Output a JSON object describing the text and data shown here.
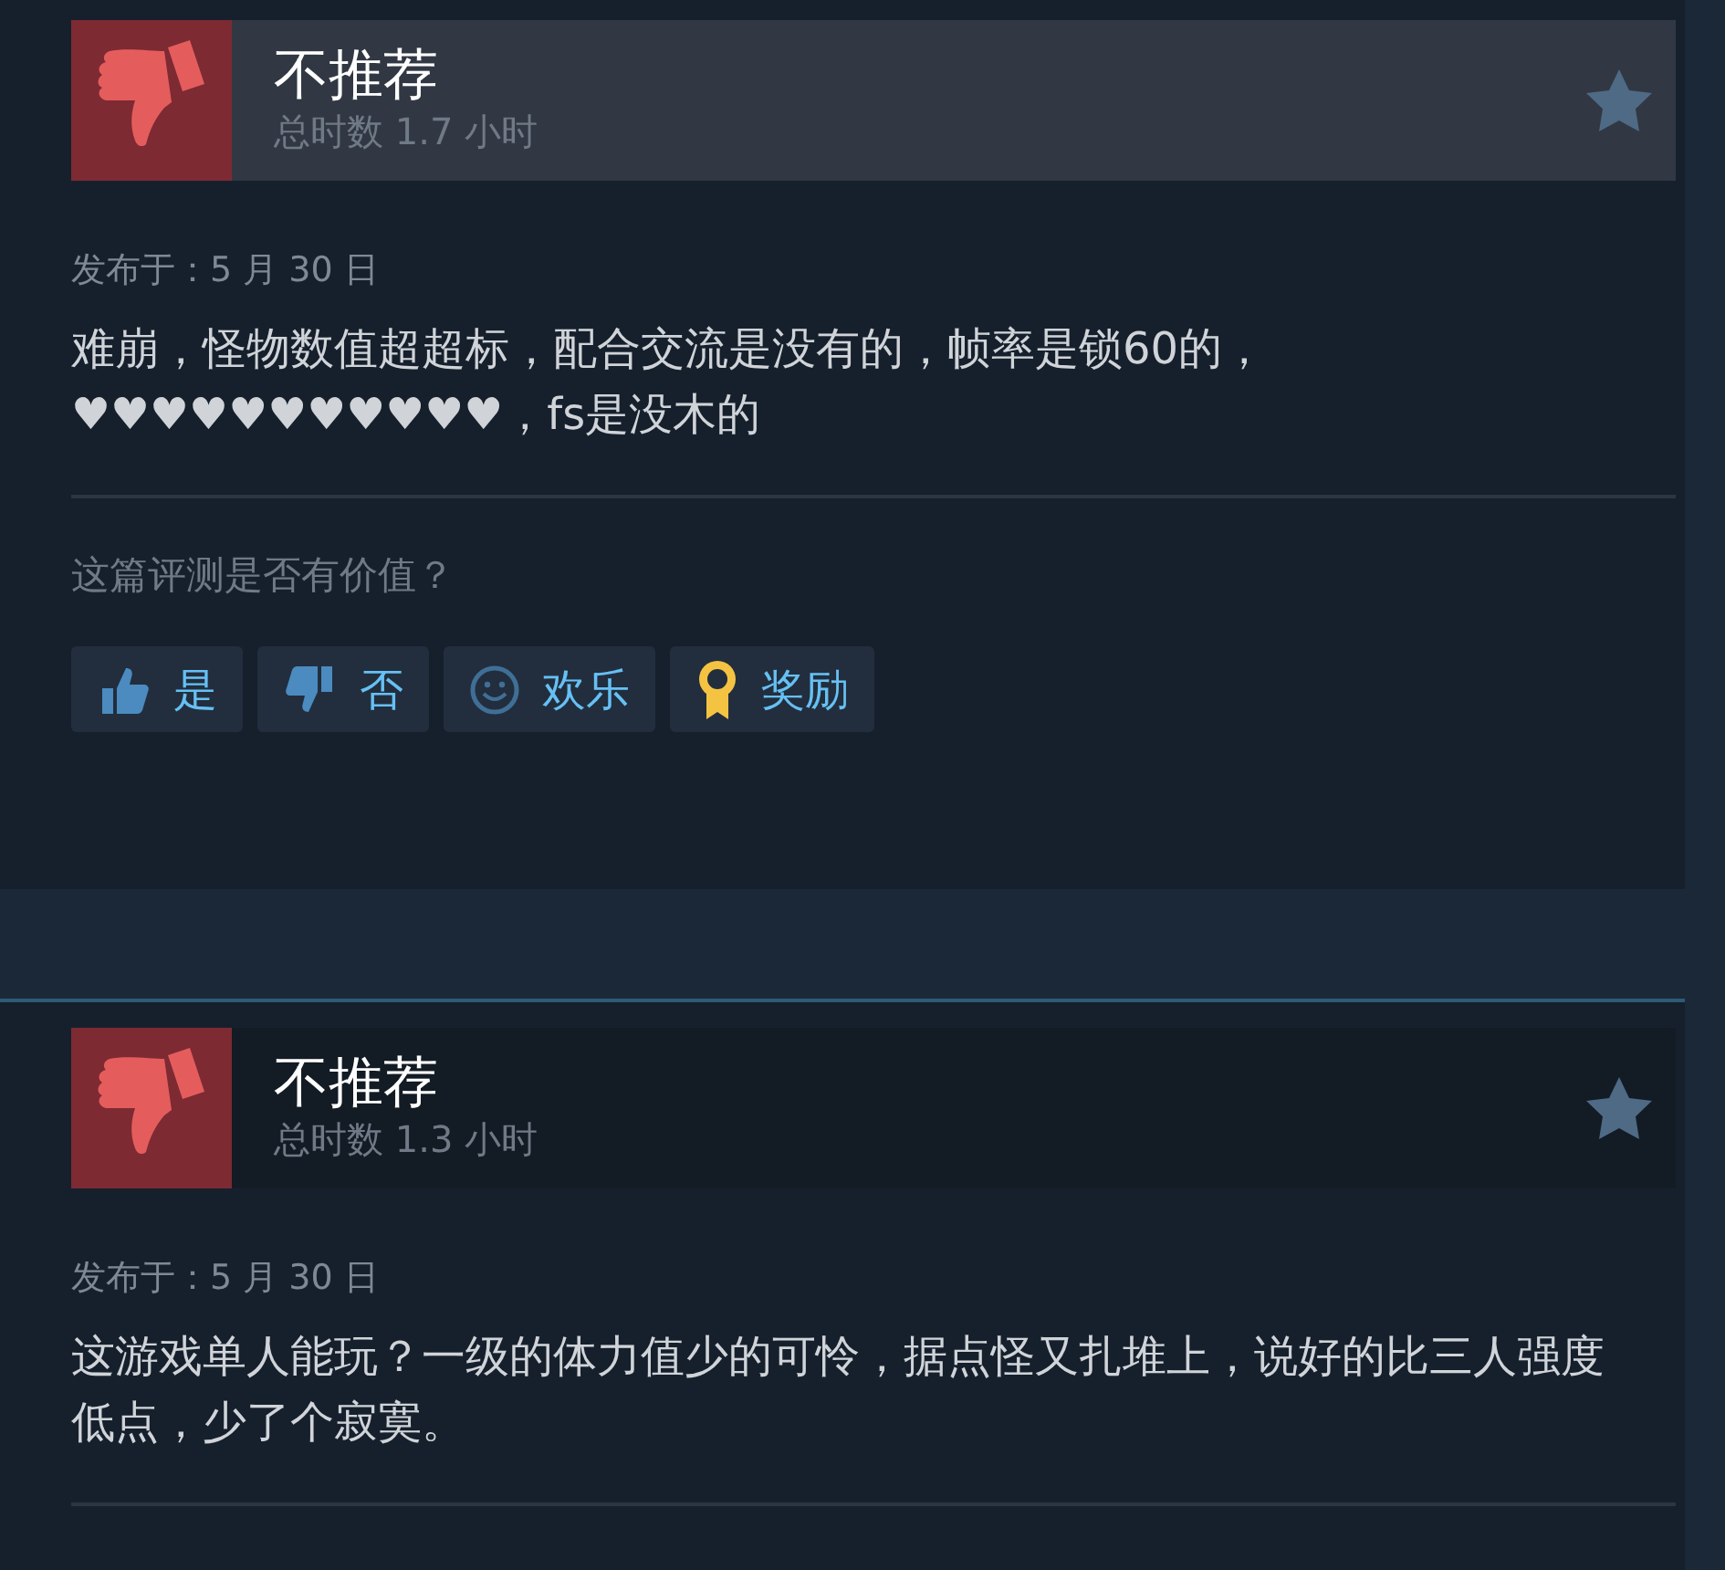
{
  "reviews": [
    {
      "verdict": "不推荐",
      "hours": "总时数 1.7 小时",
      "highlighted": true,
      "posted": "发布于：5 月 30 日",
      "text": "难崩，怪物数值超超标，配合交流是没有的，帧率是锁60的，♥♥♥♥♥♥♥♥♥♥♥，fs是没木的",
      "helpful_prompt": "这篇评测是否有价值？",
      "buttons": [
        {
          "kind": "thumb-up",
          "label": "是"
        },
        {
          "kind": "thumb-down",
          "label": "否"
        },
        {
          "kind": "smile",
          "label": "欢乐"
        },
        {
          "kind": "award",
          "label": "奖励"
        }
      ]
    },
    {
      "verdict": "不推荐",
      "hours": "总时数 1.3 小时",
      "highlighted": false,
      "posted": "发布于：5 月 30 日",
      "text": "这游戏单人能玩？一级的体力值少的可怜，据点怪又扎堆上，说好的比三人强度低点，少了个寂寞。"
    }
  ]
}
